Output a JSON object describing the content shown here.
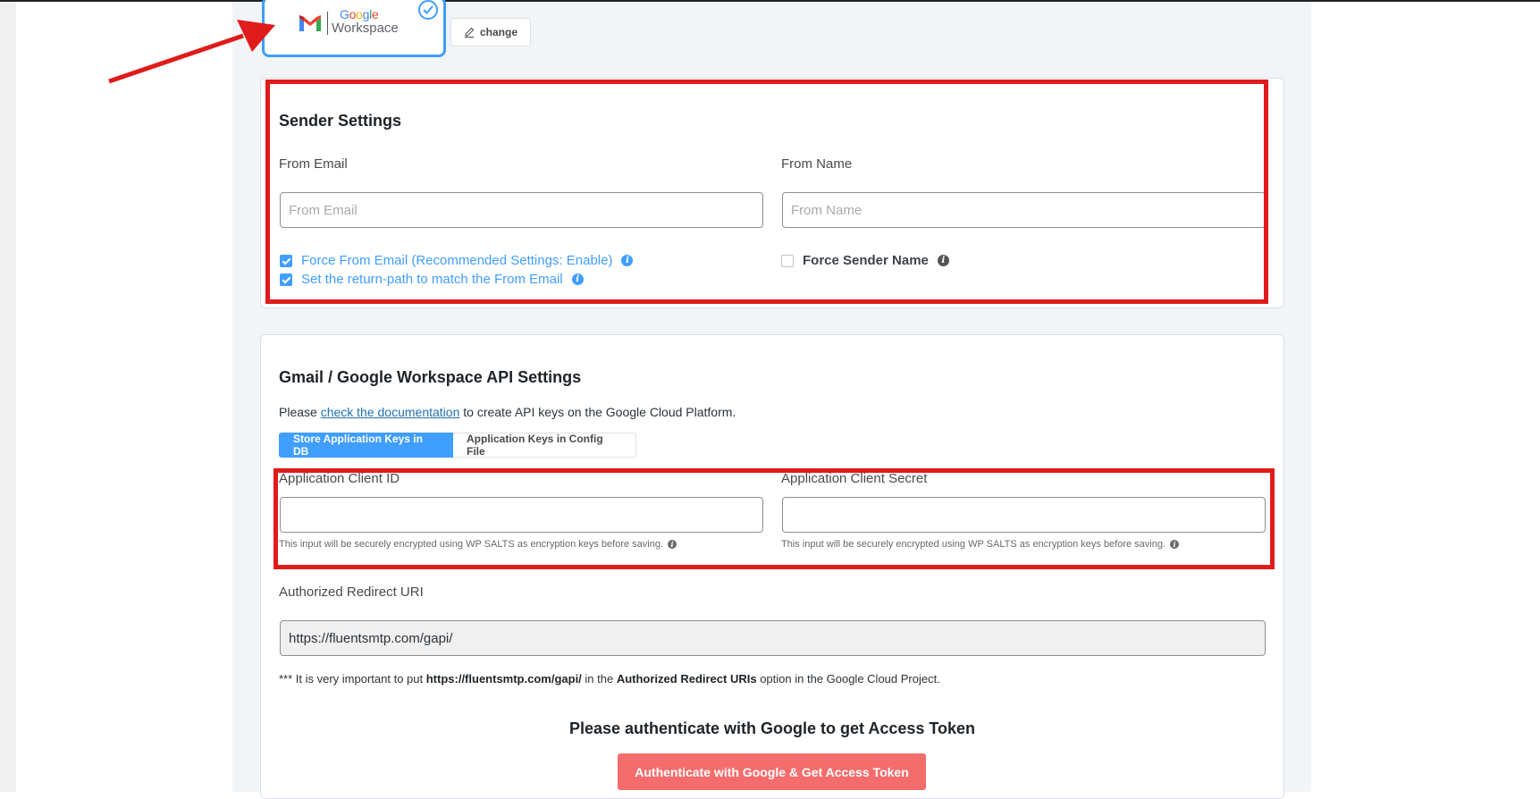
{
  "provider": {
    "logo_google": "Google",
    "logo_workspace": "Workspace",
    "change_label": "change"
  },
  "sender": {
    "title": "Sender Settings",
    "from_email_label": "From Email",
    "from_email_placeholder": "From Email",
    "from_email_value": "",
    "from_name_label": "From Name",
    "from_name_placeholder": "From Name",
    "from_name_value": "",
    "force_from_email_label": "Force From Email (Recommended Settings: Enable)",
    "force_from_email_checked": true,
    "return_path_label": "Set the return-path to match the From Email",
    "return_path_checked": true,
    "force_sender_name_label": "Force Sender Name",
    "force_sender_name_checked": false
  },
  "api": {
    "title": "Gmail / Google Workspace API Settings",
    "intro_before": "Please ",
    "intro_link": "check the documentation",
    "intro_after": " to create API keys on the Google Cloud Platform.",
    "tab_db": "Store Application Keys in DB",
    "tab_config": "Application Keys in Config File",
    "client_id_label": "Application Client ID",
    "client_id_value": "",
    "client_secret_label": "Application Client Secret",
    "client_secret_value": "",
    "encrypt_hint": "This input will be securely encrypted using WP SALTS as encryption keys before saving.",
    "redirect_label": "Authorized Redirect URI",
    "redirect_value": "https://fluentsmtp.com/gapi/",
    "important_prefix": "*** It is very important to put ",
    "important_url": "https://fluentsmtp.com/gapi/",
    "important_middle": " in the ",
    "important_option": "Authorized Redirect URIs",
    "important_suffix": " option in the Google Cloud Project.",
    "auth_title": "Please authenticate with Google to get Access Token",
    "auth_button": "Authenticate with Google & Get Access Token"
  },
  "colors": {
    "accent": "#409eff",
    "danger_button": "#f56c6c",
    "annotation": "#e01b1b"
  }
}
